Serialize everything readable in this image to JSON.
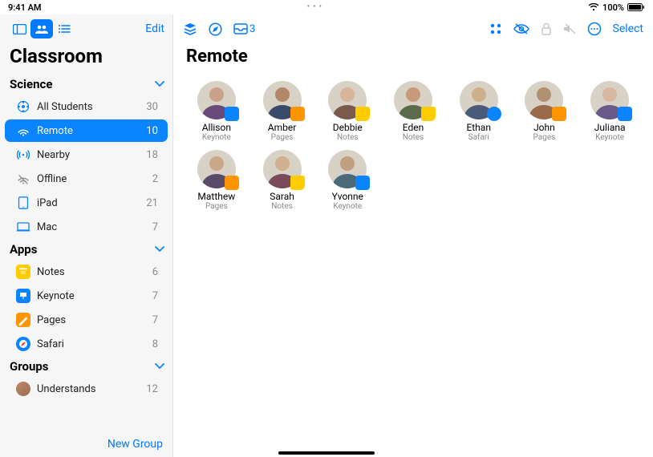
{
  "status": {
    "time": "9:41 AM",
    "battery": "100%"
  },
  "sidebar": {
    "edit": "Edit",
    "app_title": "Classroom",
    "sections": {
      "science_label": "Science",
      "apps_label": "Apps",
      "groups_label": "Groups"
    },
    "science": [
      {
        "label": "All Students",
        "count": "30"
      },
      {
        "label": "Remote",
        "count": "10",
        "selected": true
      },
      {
        "label": "Nearby",
        "count": "18"
      },
      {
        "label": "Offline",
        "count": "2"
      },
      {
        "label": "iPad",
        "count": "21"
      },
      {
        "label": "Mac",
        "count": "7"
      }
    ],
    "apps": [
      {
        "label": "Notes",
        "count": "6",
        "kind": "notes"
      },
      {
        "label": "Keynote",
        "count": "7",
        "kind": "keynote"
      },
      {
        "label": "Pages",
        "count": "7",
        "kind": "pages"
      },
      {
        "label": "Safari",
        "count": "8",
        "kind": "safari"
      }
    ],
    "groups": [
      {
        "label": "Understands",
        "count": "12"
      }
    ],
    "new_group": "New Group"
  },
  "toolbar": {
    "inbox_count": "3",
    "select": "Select"
  },
  "main": {
    "title": "Remote",
    "students": [
      {
        "name": "Allison",
        "app": "Keynote",
        "badge": "keynote",
        "tint": "a"
      },
      {
        "name": "Amber",
        "app": "Pages",
        "badge": "pages",
        "tint": "b"
      },
      {
        "name": "Debbie",
        "app": "Notes",
        "badge": "notes",
        "tint": "c"
      },
      {
        "name": "Eden",
        "app": "Notes",
        "badge": "notes",
        "tint": "d"
      },
      {
        "name": "Ethan",
        "app": "Safari",
        "badge": "safari",
        "tint": "e"
      },
      {
        "name": "John",
        "app": "Pages",
        "badge": "pages",
        "tint": "f"
      },
      {
        "name": "Juliana",
        "app": "Keynote",
        "badge": "keynote",
        "tint": "g"
      },
      {
        "name": "Matthew",
        "app": "Pages",
        "badge": "pages",
        "tint": "h"
      },
      {
        "name": "Sarah",
        "app": "Notes",
        "badge": "notes",
        "tint": "i"
      },
      {
        "name": "Yvonne",
        "app": "Keynote",
        "badge": "keynote",
        "tint": "j"
      }
    ]
  }
}
